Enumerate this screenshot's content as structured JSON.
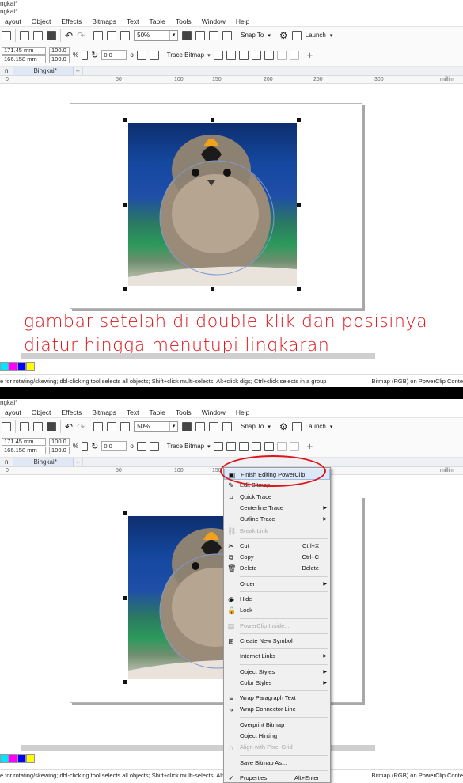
{
  "panels": [
    {
      "title_line1": "ngkai*",
      "title_line2": "ngkai*"
    },
    {
      "title_line1": "ngkai*"
    }
  ],
  "menubar": [
    "ayout",
    "Object",
    "Effects",
    "Bitmaps",
    "Text",
    "Table",
    "Tools",
    "Window",
    "Help"
  ],
  "toolbar": {
    "zoom": "50%",
    "snap_to": "Snap To",
    "launch": "Launch"
  },
  "propbar": {
    "width": "171.45 mm",
    "height": "166.158 mm",
    "scale_x": "100.0",
    "scale_y": "100.0",
    "percent": "%",
    "rotation": "0.0",
    "trace_bitmap": "Trace Bitmap"
  },
  "tabs": {
    "left": "n",
    "active": "Bingkai*",
    "plus": "+"
  },
  "ruler": {
    "ticks": [
      "0",
      "50",
      "100",
      "150",
      "200",
      "250",
      "300"
    ],
    "unit": "millim"
  },
  "caption": {
    "line1": "gambar setelah di double klik dan posisinya",
    "line2": "diatur hingga menutupi lingkaran"
  },
  "palette_colors": [
    "#00e5ff",
    "#ff00ff",
    "#0000ff",
    "#ffff00"
  ],
  "statusbar": {
    "left": "e for rotating/skewing; dbl-clicking tool selects all objects; Shift+click multi-selects; Alt+click digs; Ctrl+click selects in a group",
    "right": "Bitmap (RGB) on PowerClip Conte",
    "left2": "e for rotating/skewing; dbl-clicking tool selects all objects; Shift+click multi-selects; Alt+click digs; Ctrl+click selects in a group",
    "right2": "Bitmap (RGB) on PowerClip Conte"
  },
  "context_menu": [
    {
      "label": "Finish Editing PowerClip",
      "icon": "powerclip-icon",
      "highlight": true
    },
    {
      "label": "Edit Bitmap...",
      "icon": "edit-bitmap-icon"
    },
    {
      "label": "Quick Trace",
      "icon": "quick-trace-icon"
    },
    {
      "label": "Centerline Trace",
      "submenu": true
    },
    {
      "label": "Outline Trace",
      "submenu": true
    },
    {
      "label": "Break Link",
      "disabled": true,
      "icon": "break-link-icon"
    },
    {
      "sep": true
    },
    {
      "label": "Cut",
      "shortcut": "Ctrl+X",
      "icon": "cut-icon"
    },
    {
      "label": "Copy",
      "shortcut": "Ctrl+C",
      "icon": "copy-icon"
    },
    {
      "label": "Delete",
      "shortcut": "Delete",
      "icon": "trash-icon"
    },
    {
      "sep": true
    },
    {
      "label": "Order",
      "submenu": true
    },
    {
      "sep": true
    },
    {
      "label": "Hide",
      "icon": "eye-icon"
    },
    {
      "label": "Lock",
      "icon": "lock-icon"
    },
    {
      "sep": true
    },
    {
      "label": "PowerClip Inside...",
      "disabled": true,
      "icon": "powerclip-inside-icon"
    },
    {
      "sep": true
    },
    {
      "label": "Create New Symbol",
      "icon": "symbol-icon"
    },
    {
      "sep": true
    },
    {
      "label": "Internet Links",
      "submenu": true
    },
    {
      "sep": true
    },
    {
      "label": "Object Styles",
      "submenu": true
    },
    {
      "label": "Color Styles",
      "submenu": true
    },
    {
      "sep": true
    },
    {
      "label": "Wrap Paragraph Text",
      "icon": "wrap-text-icon"
    },
    {
      "label": "Wrap Connector Line",
      "icon": "connector-icon"
    },
    {
      "sep": true
    },
    {
      "label": "Overprint Bitmap"
    },
    {
      "label": "Object Hinting"
    },
    {
      "label": "Align with Pixel Grid",
      "disabled": true,
      "icon": "pixel-grid-icon"
    },
    {
      "sep": true
    },
    {
      "label": "Save Bitmap As..."
    },
    {
      "sep": true
    },
    {
      "label": "Properties",
      "shortcut": "Alt+Enter",
      "icon": "check-icon"
    }
  ]
}
